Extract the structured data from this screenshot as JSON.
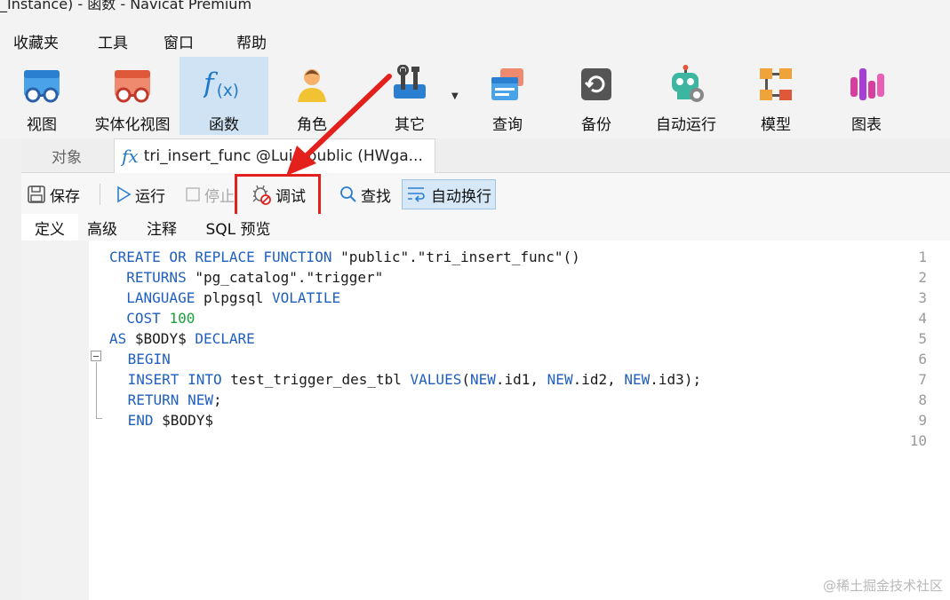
{
  "window": {
    "title": "_Instance) - 函数 - Navicat Premium"
  },
  "menu": [
    "收藏夹",
    "工具",
    "窗口",
    "帮助"
  ],
  "ribbon": [
    {
      "label": "视图",
      "icon": "view-icon",
      "active": false
    },
    {
      "label": "实体化视图",
      "icon": "materialized-view-icon",
      "active": false
    },
    {
      "label": "函数",
      "icon": "function-icon",
      "active": true
    },
    {
      "label": "角色",
      "icon": "role-icon",
      "active": false
    },
    {
      "label": "其它",
      "icon": "tools-icon",
      "active": false
    },
    {
      "label": "查询",
      "icon": "query-icon",
      "active": false
    },
    {
      "label": "备份",
      "icon": "backup-icon",
      "active": false
    },
    {
      "label": "自动运行",
      "icon": "automation-robot-icon",
      "active": false
    },
    {
      "label": "模型",
      "icon": "model-icon",
      "active": false
    },
    {
      "label": "图表",
      "icon": "chart-icon",
      "active": false
    }
  ],
  "tabs": {
    "objects": "对象",
    "document": "tri_insert_func @Luin.public (HWga..."
  },
  "toolbar": {
    "save": "保存",
    "run": "运行",
    "stop": "停止",
    "debug": "调试",
    "find": "查找",
    "wordwrap": "自动换行"
  },
  "subtabs": [
    "定义",
    "高级",
    "注释",
    "SQL 预览"
  ],
  "editor": {
    "line_numbers": [
      "1",
      "2",
      "3",
      "4",
      "5",
      "6",
      "7",
      "8",
      "9",
      "10"
    ],
    "lines": [
      [
        {
          "t": "CREATE OR REPLACE FUNCTION ",
          "k": "kw"
        },
        {
          "t": "\"public\".\"tri_insert_func\"()",
          "k": ""
        }
      ],
      [
        {
          "t": "  RETURNS ",
          "k": "kw"
        },
        {
          "t": "\"pg_catalog\".\"trigger\"",
          "k": ""
        }
      ],
      [
        {
          "t": "  LANGUAGE ",
          "k": "kw"
        },
        {
          "t": "plpgsql ",
          "k": ""
        },
        {
          "t": "VOLATILE",
          "k": "kw"
        }
      ],
      [
        {
          "t": "  COST ",
          "k": "kw"
        },
        {
          "t": "100",
          "k": "num"
        }
      ],
      [
        {
          "t": "AS ",
          "k": "kw"
        },
        {
          "t": "$BODY$ ",
          "k": ""
        },
        {
          "t": "DECLARE",
          "k": "kw"
        }
      ],
      [
        {
          "t": " BEGIN",
          "k": "kw"
        }
      ],
      [
        {
          "t": " INSERT INTO ",
          "k": "kw"
        },
        {
          "t": "test_trigger_des_tbl ",
          "k": ""
        },
        {
          "t": "VALUES",
          "k": "kw"
        },
        {
          "t": "(",
          "k": ""
        },
        {
          "t": "NEW",
          "k": "kw"
        },
        {
          "t": ".id1, ",
          "k": ""
        },
        {
          "t": "NEW",
          "k": "kw"
        },
        {
          "t": ".id2, ",
          "k": ""
        },
        {
          "t": "NEW",
          "k": "kw"
        },
        {
          "t": ".id3);",
          "k": ""
        }
      ],
      [
        {
          "t": " RETURN ",
          "k": "kw"
        },
        {
          "t": "NEW",
          "k": "kw"
        },
        {
          "t": ";",
          "k": ""
        }
      ],
      [
        {
          "t": " END ",
          "k": "kw"
        },
        {
          "t": "$BODY$",
          "k": ""
        }
      ],
      []
    ]
  },
  "watermark": "@稀土掘金技术社区",
  "colors": {
    "keyword": "#1f5fbf",
    "number": "#1aa23a",
    "highlight": "#e3201b",
    "active_ribbon": "#cfe3f5"
  }
}
